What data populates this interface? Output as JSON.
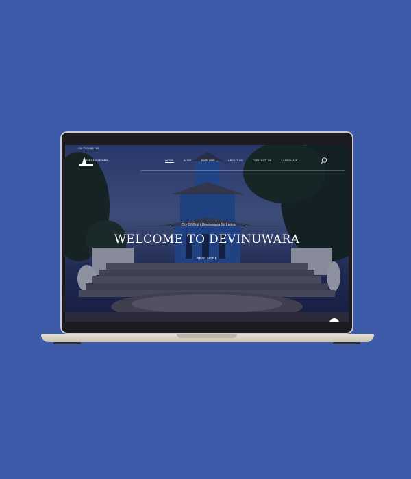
{
  "colors": {
    "page_background": "#3d5ba8",
    "hero_text": "#ffffff"
  },
  "topbar": {
    "phone": "+94 77 04 82 169"
  },
  "header": {
    "logo_text": "DEVINUWARA",
    "nav": [
      {
        "label": "HOME",
        "active": true
      },
      {
        "label": "BLOG"
      },
      {
        "label": "EXPLORE",
        "has_dropdown": true
      },
      {
        "label": "ABOUT US"
      },
      {
        "label": "CONTACT US"
      },
      {
        "label": "LANGUAGE",
        "has_dropdown": true
      }
    ],
    "search_icon": "search-icon",
    "chevron_icon": "chevron-down-icon"
  },
  "hero": {
    "tagline": "City Of God | Devinuwara Sri Lanka",
    "title": "WELCOME TO DEVINUWARA",
    "cta": "READ MORE"
  }
}
